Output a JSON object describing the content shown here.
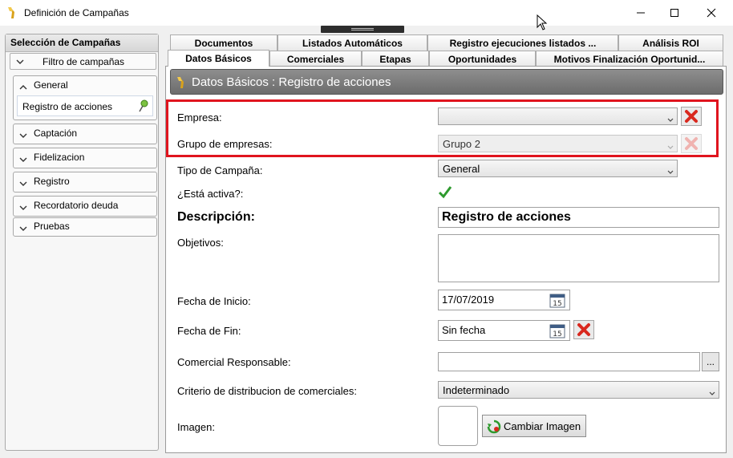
{
  "window": {
    "title": "Definición de Campañas"
  },
  "left_panel": {
    "header": "Selección de Campañas",
    "filter_label": "Filtro de campañas",
    "groups": [
      {
        "label": "General",
        "items": [
          "Registro de acciones"
        ]
      },
      {
        "label": "Captación"
      },
      {
        "label": "Fidelizacion"
      },
      {
        "label": "Registro"
      },
      {
        "label": "Recordatorio deuda"
      },
      {
        "label": "Pruebas"
      }
    ]
  },
  "tabs": {
    "row1": [
      "Documentos",
      "Listados Automáticos",
      "Registro ejecuciones listados ...",
      "Análisis ROI"
    ],
    "row2": [
      "Datos Básicos",
      "Comerciales",
      "Etapas",
      "Oportunidades",
      "Motivos Finalización Oportunid..."
    ],
    "active": "Datos Básicos"
  },
  "section": {
    "title": "Datos Básicos : Registro de acciones"
  },
  "form": {
    "empresa": {
      "label": "Empresa:",
      "value": ""
    },
    "grupo_empresas": {
      "label": "Grupo de empresas:",
      "value": "Grupo 2"
    },
    "tipo_campana": {
      "label": "Tipo de Campaña:",
      "value": "General"
    },
    "activa": {
      "label": "¿Está activa?:",
      "checked": true
    },
    "descripcion": {
      "label": "Descripción:",
      "value": "Registro de acciones"
    },
    "objetivos": {
      "label": "Objetivos:",
      "value": ""
    },
    "fecha_inicio": {
      "label": "Fecha de Inicio:",
      "value": "17/07/2019"
    },
    "fecha_fin": {
      "label": "Fecha de Fin:",
      "value": "Sin fecha"
    },
    "comercial_responsable": {
      "label": "Comercial Responsable:",
      "value": "",
      "browse_label": "..."
    },
    "criterio": {
      "label": "Criterio de distribucion de comerciales:",
      "value": "Indeterminado"
    },
    "imagen": {
      "label": "Imagen:",
      "button_label": "Cambiar Imagen"
    }
  },
  "colors": {
    "highlight": "#e0141e",
    "header_gray": "#7d7d7d",
    "delete_red": "#d9281e",
    "check_green": "#2e9a2e"
  },
  "icons": [
    "app-icon",
    "minimize-icon",
    "maximize-icon",
    "close-icon",
    "chevron-up-icon",
    "chevron-down-icon",
    "pin-icon",
    "delete-x-icon",
    "calendar-icon",
    "checkmark-icon",
    "refresh-image-icon"
  ]
}
